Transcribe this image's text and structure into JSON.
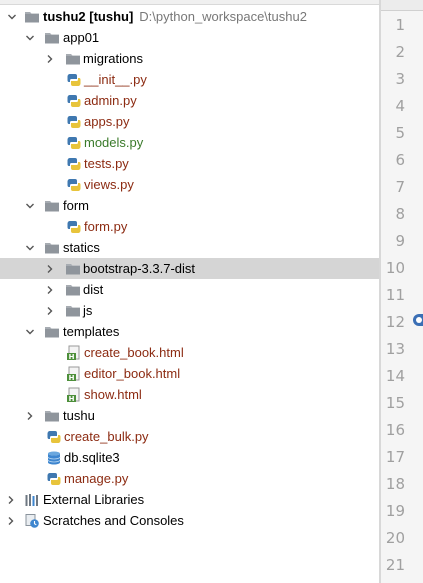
{
  "project": {
    "root": {
      "name": "tushu2",
      "module": "[tushu]",
      "path": "D:\\python_workspace\\tushu2"
    },
    "nodes": [
      {
        "label": "app01",
        "kind": "folder",
        "expanded": true
      },
      {
        "label": "migrations",
        "kind": "folder",
        "expanded": false
      },
      {
        "label": "__init__.py",
        "kind": "python"
      },
      {
        "label": "admin.py",
        "kind": "python"
      },
      {
        "label": "apps.py",
        "kind": "python"
      },
      {
        "label": "models.py",
        "kind": "python"
      },
      {
        "label": "tests.py",
        "kind": "python"
      },
      {
        "label": "views.py",
        "kind": "python"
      },
      {
        "label": "form",
        "kind": "folder",
        "expanded": true
      },
      {
        "label": "form.py",
        "kind": "python"
      },
      {
        "label": "statics",
        "kind": "folder",
        "expanded": true
      },
      {
        "label": "bootstrap-3.3.7-dist",
        "kind": "folder",
        "expanded": false,
        "selected": true
      },
      {
        "label": "dist",
        "kind": "folder",
        "expanded": false
      },
      {
        "label": "js",
        "kind": "folder",
        "expanded": false
      },
      {
        "label": "templates",
        "kind": "folder",
        "expanded": true
      },
      {
        "label": "create_book.html",
        "kind": "html"
      },
      {
        "label": "editor_book.html",
        "kind": "html"
      },
      {
        "label": "show.html",
        "kind": "html"
      },
      {
        "label": "tushu",
        "kind": "folder",
        "expanded": false
      },
      {
        "label": "create_bulk.py",
        "kind": "python"
      },
      {
        "label": "db.sqlite3",
        "kind": "database"
      },
      {
        "label": "manage.py",
        "kind": "python"
      },
      {
        "label": "External Libraries",
        "kind": "libraries",
        "expanded": false
      },
      {
        "label": "Scratches and Consoles",
        "kind": "scratches",
        "expanded": false
      }
    ]
  },
  "editor": {
    "line_numbers": [
      "1",
      "2",
      "3",
      "4",
      "5",
      "6",
      "7",
      "8",
      "9",
      "10",
      "11",
      "12",
      "13",
      "14",
      "15",
      "16",
      "17",
      "18",
      "19",
      "20",
      "21"
    ]
  },
  "colors": {
    "selection": "#d5d5d5",
    "modified_file": "#8c2b12",
    "added_file": "#3a7a2a",
    "path_text": "#787878",
    "gutter": "#f5f5f5"
  }
}
